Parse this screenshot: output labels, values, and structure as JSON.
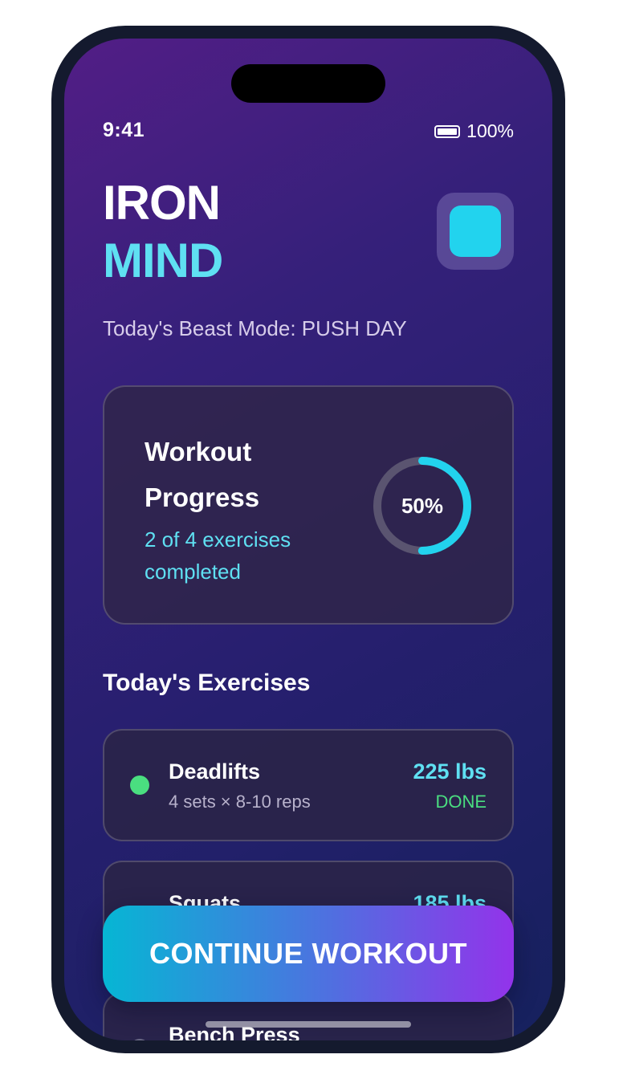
{
  "status_bar": {
    "time": "9:41",
    "battery_level": "100%",
    "battery_icon": "battery-full-icon"
  },
  "header": {
    "logo_line1": "IRON",
    "logo_line2": "MIND",
    "subtitle": "Today's Beast Mode: PUSH DAY",
    "profile_icon": "profile-tile-icon"
  },
  "progress_card": {
    "title": "Workout Progress",
    "subtitle": "2 of 4 exercises completed",
    "percent_label": "50%",
    "progress_fraction": 0.5
  },
  "exercises_section": {
    "title": "Today's Exercises",
    "items": [
      {
        "name": "Deadlifts",
        "detail": "4 sets × 8-10 reps",
        "weight": "225 lbs",
        "status": "DONE",
        "dot_color": "#4ade80"
      },
      {
        "name": "Squats",
        "detail": "",
        "weight": "185 lbs",
        "status": "",
        "dot_color": "#4ade80"
      },
      {
        "name": "Bench Press",
        "detail": "",
        "weight": "",
        "status": "",
        "dot_color": "#6b6a86"
      }
    ]
  },
  "cta": {
    "label": "CONTINUE WORKOUT"
  },
  "colors": {
    "accent_cyan": "#22d3ee",
    "accent_text_cyan": "#5fe0f2",
    "done_green": "#4ade80",
    "cta_gradient_start": "#06b6d4",
    "cta_gradient_end": "#9333ea",
    "ring_track": "#5a5470"
  }
}
